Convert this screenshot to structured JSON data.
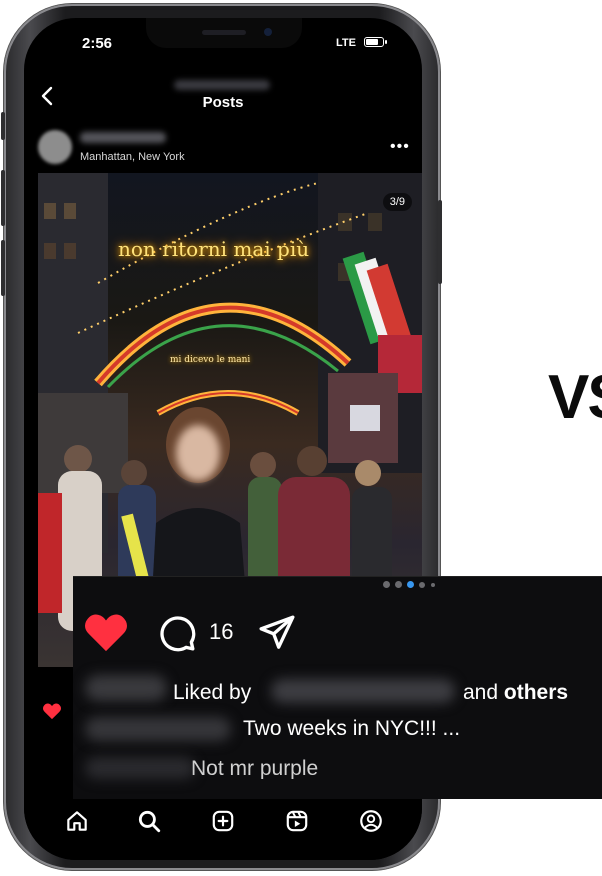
{
  "status_bar": {
    "time": "2:56",
    "network": "LTE",
    "battery_percent": 85
  },
  "header": {
    "title": "Posts"
  },
  "post": {
    "location": "Manhattan, New York",
    "image_counter": "3/9",
    "neon_top": "non ritorni mai più",
    "neon_sub": "mi dicevo le mani",
    "carousel_index": 3,
    "carousel_total": 9
  },
  "partial_text": "VS",
  "overlay": {
    "comment_count": "16",
    "liked_by_label": "Liked by",
    "and_label": "and",
    "others_label": "others",
    "caption": "Two weeks in NYC!!! ...",
    "comment_preview": "Not mr purple"
  },
  "colors": {
    "like_red": "#ff3040",
    "background": "#000000",
    "text": "#ffffff"
  },
  "bottom_nav": {
    "items": [
      "home-icon",
      "search-icon",
      "create-icon",
      "reels-icon",
      "profile-icon"
    ]
  }
}
